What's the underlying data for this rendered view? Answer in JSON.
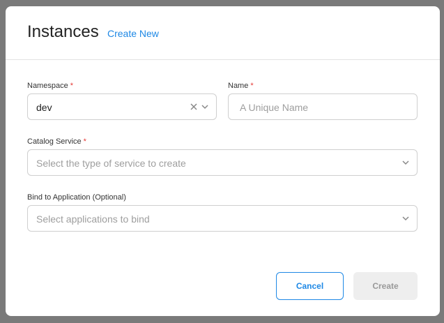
{
  "dialog": {
    "title": "Instances",
    "create_new_link": "Create New"
  },
  "form": {
    "namespace": {
      "label": "Namespace",
      "required_mark": "*",
      "value": "dev"
    },
    "name": {
      "label": "Name",
      "required_mark": "*",
      "placeholder": "A Unique Name"
    },
    "catalog_service": {
      "label": "Catalog Service",
      "required_mark": "*",
      "placeholder": "Select the type of service to create"
    },
    "bind_application": {
      "label": "Bind to Application (Optional)",
      "placeholder": "Select applications to bind"
    }
  },
  "actions": {
    "cancel_label": "Cancel",
    "create_label": "Create"
  },
  "colors": {
    "accent": "#1e88e5",
    "required": "#e53935",
    "overlay": "#7a7a7a"
  }
}
